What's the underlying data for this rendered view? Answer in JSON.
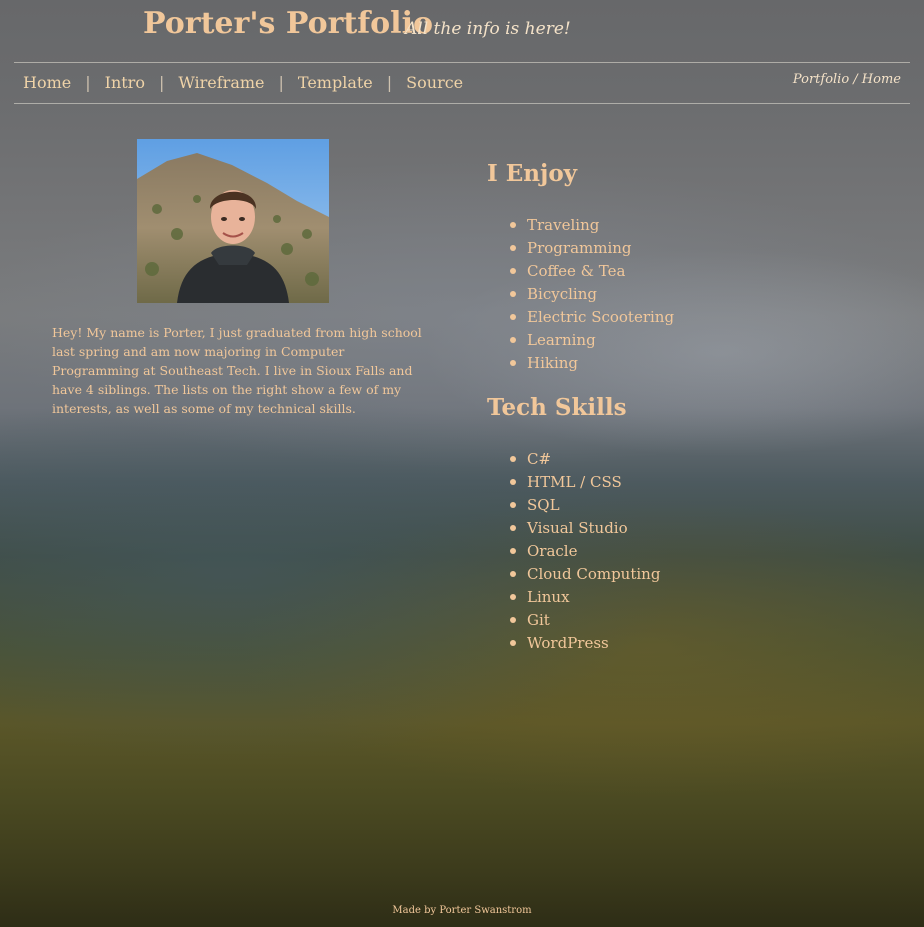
{
  "header": {
    "title": "Porter's Portfolio",
    "tagline": "All the info is here!"
  },
  "nav": {
    "items": [
      {
        "label": "Home"
      },
      {
        "label": "Intro"
      },
      {
        "label": "Wireframe"
      },
      {
        "label": "Template"
      },
      {
        "label": "Source"
      }
    ],
    "separator": "|",
    "breadcrumb": "Portfolio / Home"
  },
  "intro": {
    "bio": "Hey! My name is Porter, I just graduated from high school last spring and am now majoring in Computer Programming at Southeast Tech. I live in Sioux Falls and have 4 siblings. The lists on the right show a few of my interests, as well as some of my technical skills."
  },
  "enjoy": {
    "title": "I Enjoy",
    "items": [
      "Traveling",
      "Programming",
      "Coffee & Tea",
      "Bicycling",
      "Electric Scootering",
      "Learning",
      "Hiking"
    ]
  },
  "skills": {
    "title": "Tech Skills",
    "items": [
      "C#",
      "HTML / CSS",
      "SQL",
      "Visual Studio",
      "Oracle",
      "Cloud Computing",
      "Linux",
      "Git",
      "WordPress"
    ]
  },
  "footer": {
    "text": "Made by Porter Swanstrom"
  },
  "colors": {
    "accent": "#f1c79a",
    "tagline": "#f4e2c8",
    "divider": "#e6e1d7"
  }
}
